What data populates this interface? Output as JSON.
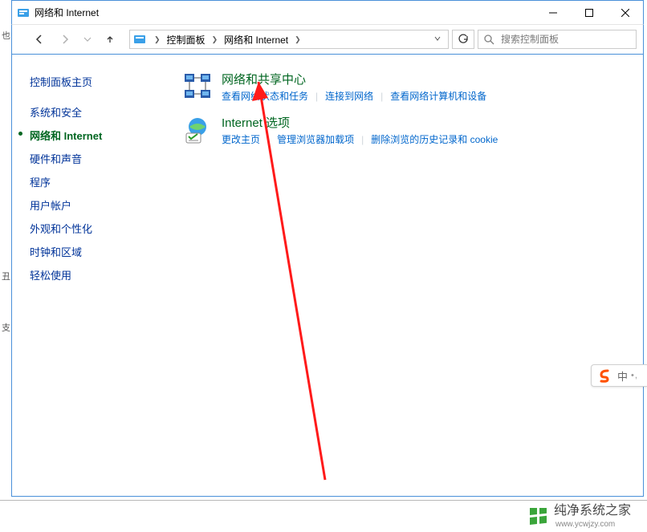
{
  "titlebar": {
    "title": "网络和 Internet"
  },
  "breadcrumb": {
    "root": "控制面板",
    "current": "网络和 Internet"
  },
  "search": {
    "placeholder": "搜索控制面板"
  },
  "sidebar": {
    "heading": "控制面板主页",
    "items": [
      {
        "label": "系统和安全",
        "active": false
      },
      {
        "label": "网络和 Internet",
        "active": true
      },
      {
        "label": "硬件和声音",
        "active": false
      },
      {
        "label": "程序",
        "active": false
      },
      {
        "label": "用户帐户",
        "active": false
      },
      {
        "label": "外观和个性化",
        "active": false
      },
      {
        "label": "时钟和区域",
        "active": false
      },
      {
        "label": "轻松使用",
        "active": false
      }
    ]
  },
  "categories": [
    {
      "title": "网络和共享中心",
      "links": [
        "查看网络状态和任务",
        "连接到网络",
        "查看网络计算机和设备"
      ]
    },
    {
      "title": "Internet 选项",
      "links": [
        "更改主页",
        "管理浏览器加载项",
        "删除浏览的历史记录和 cookie"
      ]
    }
  ],
  "ime": {
    "label": "中"
  },
  "watermark": {
    "name": "纯净系统之家",
    "url": "www.ycwjzy.com"
  },
  "leftstrip": [
    "也",
    "丑",
    "支"
  ]
}
